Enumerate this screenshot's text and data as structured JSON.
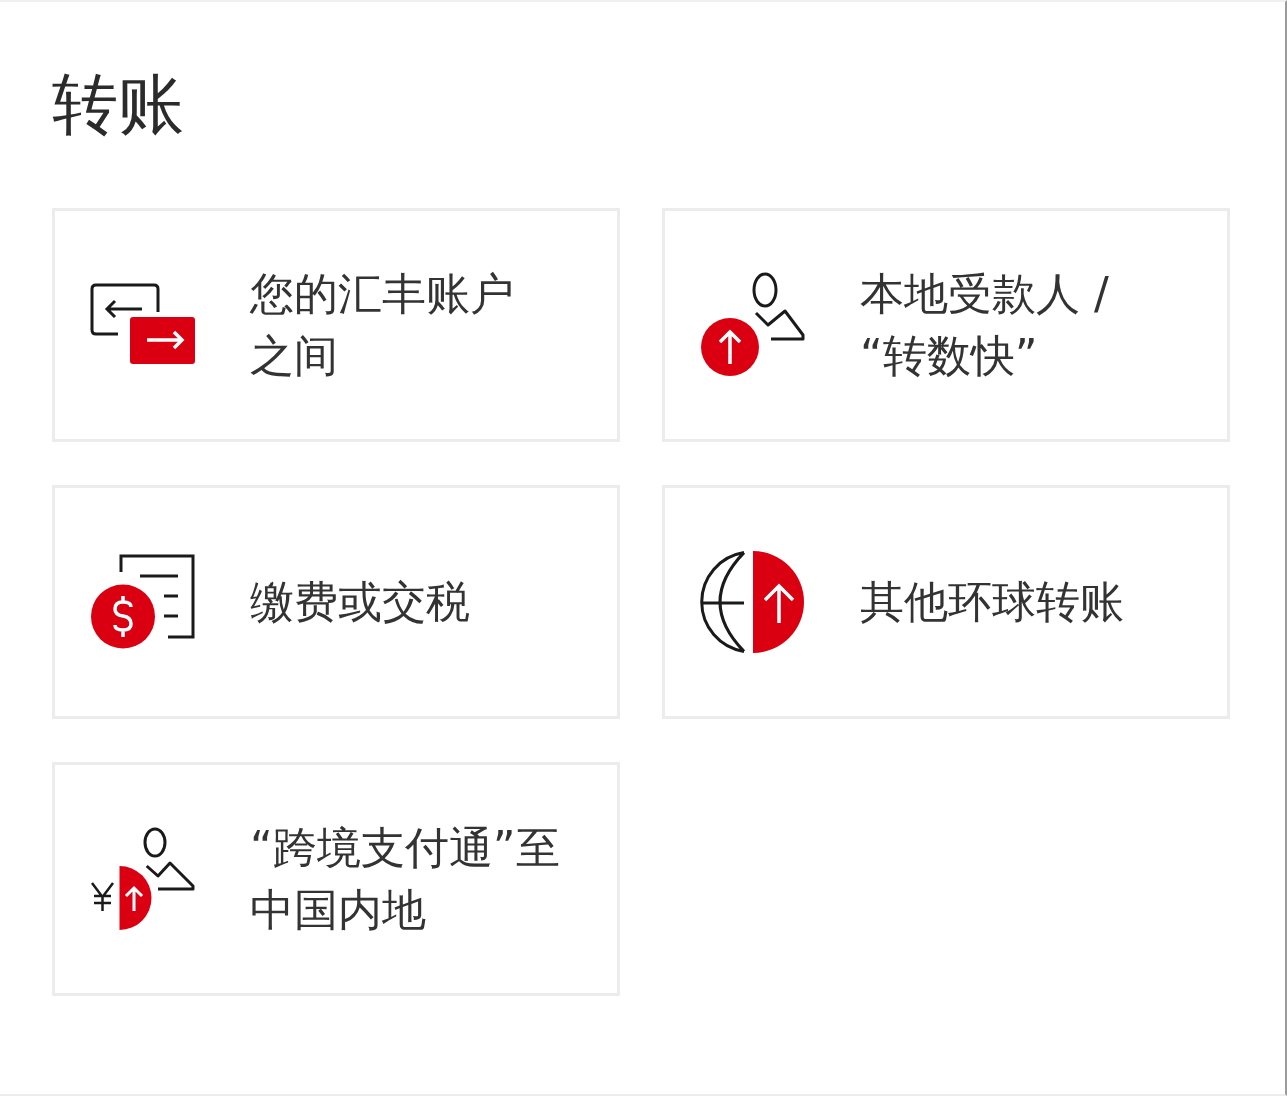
{
  "title": "转账",
  "options": [
    {
      "kind": "accounts",
      "lines": [
        "您的汇丰账户",
        "之间"
      ]
    },
    {
      "kind": "payee",
      "lines": [
        "本地受款人 /",
        "“转数快”"
      ]
    },
    {
      "kind": "bills",
      "lines": [
        "缴费或交税"
      ]
    },
    {
      "kind": "global",
      "lines": [
        "其他环球转账"
      ]
    },
    {
      "kind": "crossborder",
      "lines": [
        "“跨境支付通”至",
        "中国内地"
      ]
    }
  ]
}
